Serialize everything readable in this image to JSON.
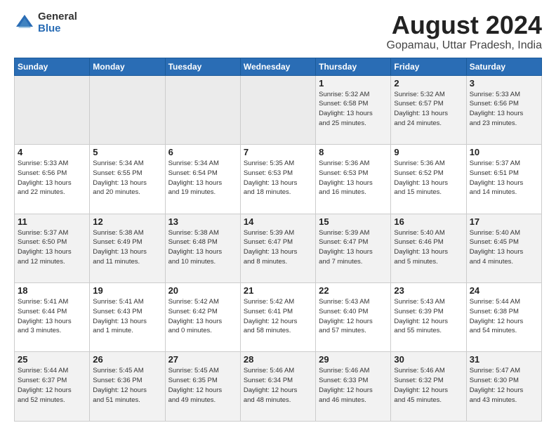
{
  "logo": {
    "general": "General",
    "blue": "Blue"
  },
  "header": {
    "month": "August 2024",
    "location": "Gopamau, Uttar Pradesh, India"
  },
  "weekdays": [
    "Sunday",
    "Monday",
    "Tuesday",
    "Wednesday",
    "Thursday",
    "Friday",
    "Saturday"
  ],
  "weeks": [
    [
      {
        "day": "",
        "info": ""
      },
      {
        "day": "",
        "info": ""
      },
      {
        "day": "",
        "info": ""
      },
      {
        "day": "",
        "info": ""
      },
      {
        "day": "1",
        "info": "Sunrise: 5:32 AM\nSunset: 6:58 PM\nDaylight: 13 hours\nand 25 minutes."
      },
      {
        "day": "2",
        "info": "Sunrise: 5:32 AM\nSunset: 6:57 PM\nDaylight: 13 hours\nand 24 minutes."
      },
      {
        "day": "3",
        "info": "Sunrise: 5:33 AM\nSunset: 6:56 PM\nDaylight: 13 hours\nand 23 minutes."
      }
    ],
    [
      {
        "day": "4",
        "info": "Sunrise: 5:33 AM\nSunset: 6:56 PM\nDaylight: 13 hours\nand 22 minutes."
      },
      {
        "day": "5",
        "info": "Sunrise: 5:34 AM\nSunset: 6:55 PM\nDaylight: 13 hours\nand 20 minutes."
      },
      {
        "day": "6",
        "info": "Sunrise: 5:34 AM\nSunset: 6:54 PM\nDaylight: 13 hours\nand 19 minutes."
      },
      {
        "day": "7",
        "info": "Sunrise: 5:35 AM\nSunset: 6:53 PM\nDaylight: 13 hours\nand 18 minutes."
      },
      {
        "day": "8",
        "info": "Sunrise: 5:36 AM\nSunset: 6:53 PM\nDaylight: 13 hours\nand 16 minutes."
      },
      {
        "day": "9",
        "info": "Sunrise: 5:36 AM\nSunset: 6:52 PM\nDaylight: 13 hours\nand 15 minutes."
      },
      {
        "day": "10",
        "info": "Sunrise: 5:37 AM\nSunset: 6:51 PM\nDaylight: 13 hours\nand 14 minutes."
      }
    ],
    [
      {
        "day": "11",
        "info": "Sunrise: 5:37 AM\nSunset: 6:50 PM\nDaylight: 13 hours\nand 12 minutes."
      },
      {
        "day": "12",
        "info": "Sunrise: 5:38 AM\nSunset: 6:49 PM\nDaylight: 13 hours\nand 11 minutes."
      },
      {
        "day": "13",
        "info": "Sunrise: 5:38 AM\nSunset: 6:48 PM\nDaylight: 13 hours\nand 10 minutes."
      },
      {
        "day": "14",
        "info": "Sunrise: 5:39 AM\nSunset: 6:47 PM\nDaylight: 13 hours\nand 8 minutes."
      },
      {
        "day": "15",
        "info": "Sunrise: 5:39 AM\nSunset: 6:47 PM\nDaylight: 13 hours\nand 7 minutes."
      },
      {
        "day": "16",
        "info": "Sunrise: 5:40 AM\nSunset: 6:46 PM\nDaylight: 13 hours\nand 5 minutes."
      },
      {
        "day": "17",
        "info": "Sunrise: 5:40 AM\nSunset: 6:45 PM\nDaylight: 13 hours\nand 4 minutes."
      }
    ],
    [
      {
        "day": "18",
        "info": "Sunrise: 5:41 AM\nSunset: 6:44 PM\nDaylight: 13 hours\nand 3 minutes."
      },
      {
        "day": "19",
        "info": "Sunrise: 5:41 AM\nSunset: 6:43 PM\nDaylight: 13 hours\nand 1 minute."
      },
      {
        "day": "20",
        "info": "Sunrise: 5:42 AM\nSunset: 6:42 PM\nDaylight: 13 hours\nand 0 minutes."
      },
      {
        "day": "21",
        "info": "Sunrise: 5:42 AM\nSunset: 6:41 PM\nDaylight: 12 hours\nand 58 minutes."
      },
      {
        "day": "22",
        "info": "Sunrise: 5:43 AM\nSunset: 6:40 PM\nDaylight: 12 hours\nand 57 minutes."
      },
      {
        "day": "23",
        "info": "Sunrise: 5:43 AM\nSunset: 6:39 PM\nDaylight: 12 hours\nand 55 minutes."
      },
      {
        "day": "24",
        "info": "Sunrise: 5:44 AM\nSunset: 6:38 PM\nDaylight: 12 hours\nand 54 minutes."
      }
    ],
    [
      {
        "day": "25",
        "info": "Sunrise: 5:44 AM\nSunset: 6:37 PM\nDaylight: 12 hours\nand 52 minutes."
      },
      {
        "day": "26",
        "info": "Sunrise: 5:45 AM\nSunset: 6:36 PM\nDaylight: 12 hours\nand 51 minutes."
      },
      {
        "day": "27",
        "info": "Sunrise: 5:45 AM\nSunset: 6:35 PM\nDaylight: 12 hours\nand 49 minutes."
      },
      {
        "day": "28",
        "info": "Sunrise: 5:46 AM\nSunset: 6:34 PM\nDaylight: 12 hours\nand 48 minutes."
      },
      {
        "day": "29",
        "info": "Sunrise: 5:46 AM\nSunset: 6:33 PM\nDaylight: 12 hours\nand 46 minutes."
      },
      {
        "day": "30",
        "info": "Sunrise: 5:46 AM\nSunset: 6:32 PM\nDaylight: 12 hours\nand 45 minutes."
      },
      {
        "day": "31",
        "info": "Sunrise: 5:47 AM\nSunset: 6:30 PM\nDaylight: 12 hours\nand 43 minutes."
      }
    ]
  ]
}
